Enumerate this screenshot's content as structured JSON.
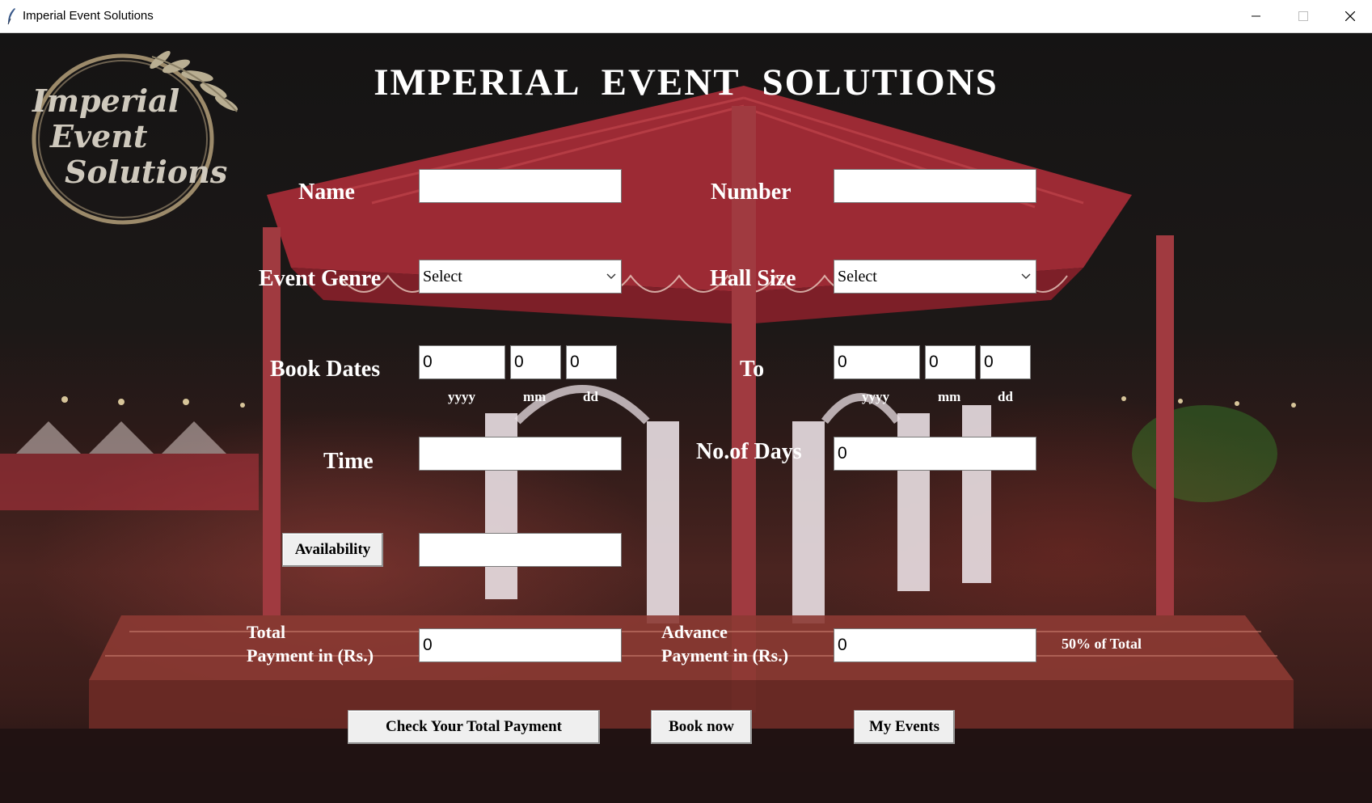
{
  "window": {
    "title": "Imperial Event Solutions"
  },
  "logo": {
    "line1": "Imperial",
    "line2": "Event",
    "line3": "Solutions"
  },
  "heading": "IMPERIAL  EVENT  SOLUTIONS",
  "form": {
    "name_label": "Name",
    "name_value": "",
    "number_label": "Number",
    "number_value": "",
    "event_genre_label": "Event Genre",
    "event_genre_value": "Select",
    "hall_size_label": "Hall Size",
    "hall_size_value": "Select",
    "book_dates_label": "Book Dates",
    "from_date": {
      "yyyy": "0",
      "mm": "0",
      "dd": "0"
    },
    "to_label": "To",
    "to_date": {
      "yyyy": "0",
      "mm": "0",
      "dd": "0"
    },
    "date_units": {
      "yyyy": "yyyy",
      "mm": "mm",
      "dd": "dd"
    },
    "time_label": "Time",
    "time_value": "",
    "days_label": "No.of Days",
    "days_value": "0",
    "availability_button": "Availability",
    "availability_value": "",
    "total_payment_label_line1": "Total",
    "total_payment_label_line2": "Payment in (Rs.)",
    "total_payment_value": "0",
    "advance_payment_label_line1": "Advance",
    "advance_payment_label_line2": "Payment in (Rs.)",
    "advance_payment_value": "0",
    "advance_note": "50% of Total"
  },
  "actions": {
    "check_total": "Check Your Total Payment",
    "book_now": "Book now",
    "my_events": "My Events"
  },
  "colors": {
    "text": "#ffffff",
    "field_bg": "#ffffff",
    "button_bg": "#efefef",
    "canopy_red": "#a8303a"
  }
}
